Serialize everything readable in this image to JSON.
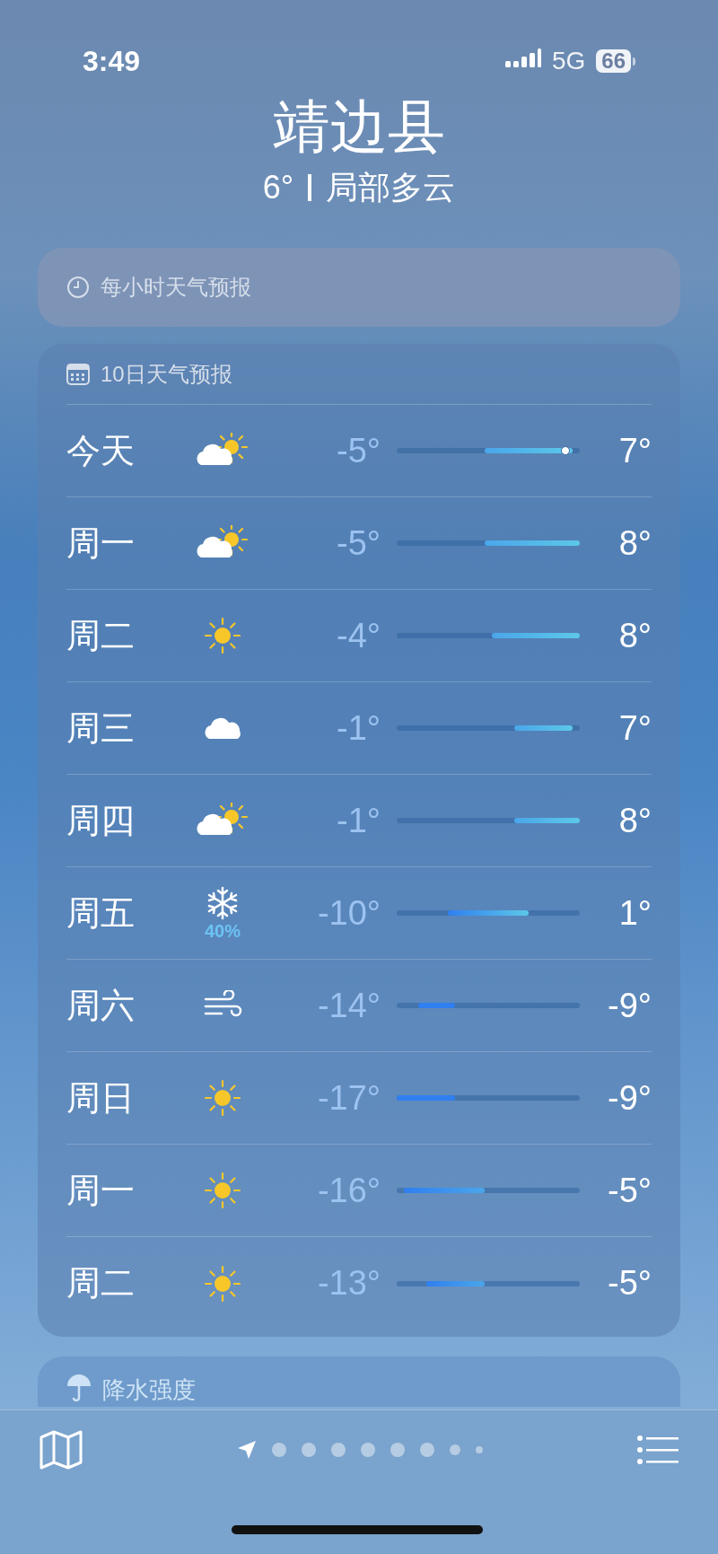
{
  "status_bar": {
    "time": "3:49",
    "network": "5G",
    "battery": "66"
  },
  "location": {
    "name": "靖边县",
    "temperature": "6°",
    "condition": "局部多云"
  },
  "hourly_card": {
    "title": "每小时天气预报"
  },
  "daily_card": {
    "title": "10日天气预报",
    "rows": [
      {
        "day": "今天",
        "kind": "partly-cloudy",
        "low": "-5°",
        "high": "7°",
        "now_marker": true
      },
      {
        "day": "周一",
        "kind": "partly-cloudy",
        "low": "-5°",
        "high": "8°",
        "now_marker": false
      },
      {
        "day": "周二",
        "kind": "sunny",
        "low": "-4°",
        "high": "8°",
        "now_marker": false
      },
      {
        "day": "周三",
        "kind": "cloudy",
        "low": "-1°",
        "high": "7°",
        "now_marker": false
      },
      {
        "day": "周四",
        "kind": "partly-cloudy",
        "low": "-1°",
        "high": "8°",
        "now_marker": false
      },
      {
        "day": "周五",
        "kind": "snow",
        "precip": "40%",
        "low": "-10°",
        "high": "1°",
        "now_marker": false
      },
      {
        "day": "周六",
        "kind": "wind",
        "low": "-14°",
        "high": "-9°",
        "now_marker": false
      },
      {
        "day": "周日",
        "kind": "sunny",
        "low": "-17°",
        "high": "-9°",
        "now_marker": false
      },
      {
        "day": "周一",
        "kind": "sunny",
        "low": "-16°",
        "high": "-5°",
        "now_marker": false
      },
      {
        "day": "周二",
        "kind": "sunny",
        "low": "-13°",
        "high": "-5°",
        "now_marker": false
      }
    ]
  },
  "precipitation_card": {
    "title": "降水强度"
  },
  "pages": [
    {
      "kind": "location",
      "selected": true
    },
    {
      "kind": "dot",
      "selected": false
    },
    {
      "kind": "dot",
      "selected": false
    },
    {
      "kind": "dot",
      "selected": false
    },
    {
      "kind": "dot",
      "selected": false
    },
    {
      "kind": "dot",
      "selected": false
    },
    {
      "kind": "dot",
      "selected": false
    },
    {
      "kind": "dot",
      "selected": false
    },
    {
      "kind": "dot",
      "selected": false
    }
  ]
}
